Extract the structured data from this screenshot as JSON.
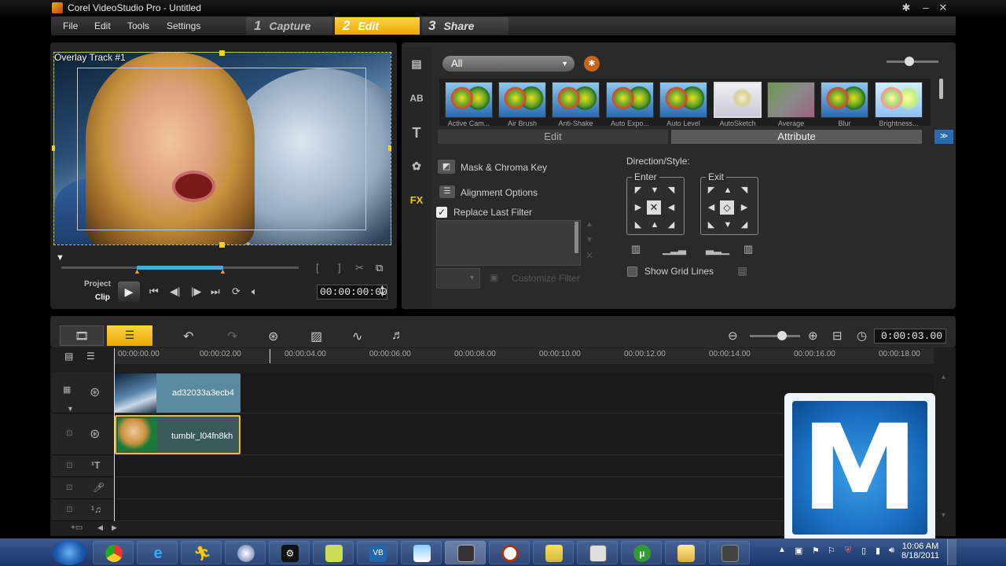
{
  "window": {
    "title": "Corel VideoStudio Pro - Untitled"
  },
  "menu": [
    "File",
    "Edit",
    "Tools",
    "Settings"
  ],
  "steps": [
    {
      "num": "1",
      "label": "Capture"
    },
    {
      "num": "2",
      "label": "Edit"
    },
    {
      "num": "3",
      "label": "Share"
    }
  ],
  "preview": {
    "overlay_label": "Overlay Track #1",
    "mode_project": "Project",
    "mode_clip": "Clip",
    "timecode": "00:00:00:00"
  },
  "library": {
    "dropdown": "All",
    "filters": [
      "Active Cam...",
      "Air Brush",
      "Anti-Shake",
      "Auto Expo...",
      "Auto Level",
      "AutoSketch",
      "Average",
      "Blur",
      "Brightness..."
    ],
    "tab_edit": "Edit",
    "tab_attribute": "Attribute",
    "mask": "Mask & Chroma Key",
    "alignment": "Alignment Options",
    "replace": "Replace Last Filter",
    "customize": "Customize Filter",
    "direction": "Direction/Style:",
    "enter": "Enter",
    "exit": "Exit",
    "grid": "Show Grid Lines"
  },
  "timeline": {
    "timecode": "0:00:03.00",
    "ruler": [
      "00:00:00.00",
      "00:00:02.00",
      "00:00:04.00",
      "00:00:06.00",
      "00:00:08.00",
      "00:00:10.00",
      "00:00:12.00",
      "00:00:14.00",
      "00:00:16.00",
      "00:00:18.00"
    ],
    "clip_video": "ad32033a3ecb4",
    "clip_overlay": "tumblr_l04fn8kh"
  },
  "taskbar": {
    "time": "10:06 AM",
    "date": "8/18/2011"
  }
}
